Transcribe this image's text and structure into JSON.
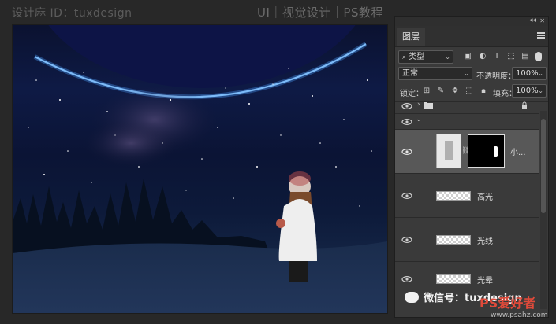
{
  "watermark": {
    "left": "设计麻 ID：tuxdesign",
    "right": "UI｜视觉设计｜PS教程",
    "bottom": "微信号：tuxdesign",
    "bottom_brand": "PS爱好者",
    "bottom_site": "www.psahz.com"
  },
  "panel": {
    "tab_label": "图层",
    "filter_label": "类型",
    "blend_mode": "正常",
    "opacity_label": "不透明度：",
    "opacity_value": "100%",
    "lock_label": "锁定：",
    "fill_label": "填充：",
    "fill_value": "100%",
    "layers": [
      {
        "name": "",
        "type": "group-collapsed"
      },
      {
        "name": "",
        "type": "group-open"
      },
      {
        "name": "小...",
        "type": "mask-layer"
      },
      {
        "name": "高光",
        "type": "layer"
      },
      {
        "name": "光线",
        "type": "layer"
      },
      {
        "name": "光晕",
        "type": "layer"
      }
    ]
  },
  "colors": {
    "background": "#282828",
    "panel": "#3a3a3a",
    "selected_layer": "#585858"
  }
}
